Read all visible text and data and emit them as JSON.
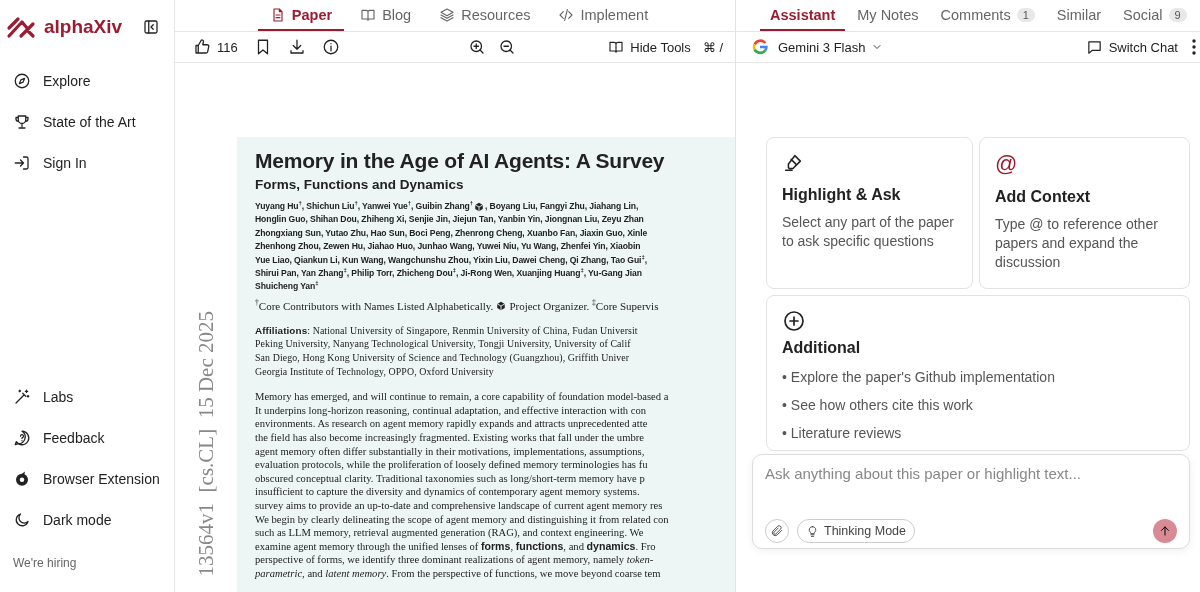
{
  "sidebar": {
    "brand": "alphaXiv",
    "nav": [
      {
        "label": "Explore"
      },
      {
        "label": "State of the Art"
      },
      {
        "label": "Sign In"
      }
    ],
    "bottom": [
      {
        "label": "Labs"
      },
      {
        "label": "Feedback"
      },
      {
        "label": "Browser Extension"
      },
      {
        "label": "Dark mode"
      }
    ],
    "hiring": "We're hiring"
  },
  "paper_tabs": [
    {
      "label": "Paper",
      "selected": true
    },
    {
      "label": "Blog",
      "selected": false
    },
    {
      "label": "Resources",
      "selected": false
    },
    {
      "label": "Implement",
      "selected": false
    }
  ],
  "paper_toolbar": {
    "likes": "116",
    "hide_tools": "Hide Tools",
    "shortcut": "⌘ /"
  },
  "paper": {
    "stamp": "13564v1  [cs.CL]  15 Dec 2025",
    "title": "Memory in the Age of AI Agents: A Survey",
    "subtitle": "Forms, Functions and Dynamics",
    "author_lines": [
      [
        "Yuyang Hu$^{†}$, Shichun Liu$^{†}$, Yanwei Yue$^{†}$, Guibin Zhang$^{†}$",
        ", Boyang Liu, Fangyi Zhu, Jiahang Lin,"
      ],
      [
        "Honglin Guo, Shihan Dou, Zhiheng Xi, Senjie Jin, Jiejun Tan, Yanbin Yin, Jiongnan Liu, Zeyu Zhan"
      ],
      [
        "Zhongxiang Sun, Yutao Zhu, Hao Sun, Boci Peng, Zhenrong Cheng, Xuanbo Fan, Jiaxin Guo, Xinle"
      ],
      [
        "Zhenhong Zhou, Zewen Hu, Jiahao Huo, Junhao Wang, Yuwei Niu, Yu Wang, Zhenfei Yin, Xiaobin"
      ],
      [
        "Yue Liao, Qiankun Li, Kun Wang, Wangchunshu Zhou, Yixin Liu, Dawei Cheng, Qi Zhang, Tao Gui$^{‡}$,"
      ],
      [
        "Shirui Pan, Yan Zhang$^{‡}$, Philip Torr, Zhicheng Dou$^{‡}$, Ji-Rong Wen, Xuanjing Huang$^{‡}$, Yu-Gang Jian"
      ],
      [
        "Shuicheng Yan$^{‡}$"
      ]
    ],
    "footnote": [
      "$^{†}$Core Contributors with Names Listed Alphabetically.",
      "Project Organizer. $^{‡}$Core Supervis"
    ],
    "affiliations": [
      "**Affiliations**: National University of Singapore, Renmin University of China, Fudan Universit",
      "Peking University, Nanyang Technological University, Tongji University, University of Calif",
      "San Diego, Hong Kong University of Science and Technology (Guangzhou), Griffith Univer",
      "Georgia Institute of Technology, OPPO, Oxford University"
    ],
    "abstract": [
      "Memory has emerged, and will continue to remain, a core capability of foundation model-based a",
      "It underpins long-horizon reasoning, continual adaptation, and effective interaction with con",
      "environments. As research on agent memory rapidly expands and attracts unprecedented atte",
      "the field has also become increasingly fragmented. Existing works that fall under the umbre",
      "agent memory often differ substantially in their motivations, implementations, assumptions,",
      "evaluation protocols, while the proliferation of loosely defined memory terminologies has fu",
      "obscured conceptual clarity. Traditional taxonomies such as long/short-term memory have p",
      "insufficient to capture the diversity and dynamics of contemporary agent memory systems.",
      "survey aims to provide an up-to-date and comprehensive landscape of current agent memory res",
      "We begin by clearly delineating the scope of agent memory and distinguishing it from related con",
      "such as LLM memory, retrieval augmented generation (RAG), and context engineering. We",
      "examine agent memory through the unified lenses of **forms**, **functions**, and **dynamics**. Fro",
      "perspective of forms, we identify three dominant realizations of agent memory, namely *token-*",
      "*parametric*, and *latent memory*. From the perspective of functions, we move beyond coarse tem"
    ]
  },
  "assistant_tabs": [
    {
      "label": "Assistant",
      "selected": true
    },
    {
      "label": "My Notes",
      "selected": false
    },
    {
      "label": "Comments",
      "count": "1",
      "selected": false
    },
    {
      "label": "Similar",
      "selected": false
    },
    {
      "label": "Social",
      "count": "9",
      "selected": false
    }
  ],
  "model": {
    "name": "Gemini 3 Flash"
  },
  "switch_chat": "Switch Chat",
  "cards": [
    {
      "title": "Highlight & Ask",
      "text": "Select any part of the paper to ask specific questions"
    },
    {
      "icon_text": "@",
      "title": "Add Context",
      "text": "Type @ to reference other papers and expand the discussion"
    }
  ],
  "additional": {
    "title": "Additional",
    "items": [
      "• Explore the paper's Github implementation",
      "• See how others cite this work",
      "• Literature reviews"
    ]
  },
  "composer": {
    "placeholder": "Ask anything about this paper or highlight text...",
    "thinking_mode": "Thinking Mode"
  }
}
